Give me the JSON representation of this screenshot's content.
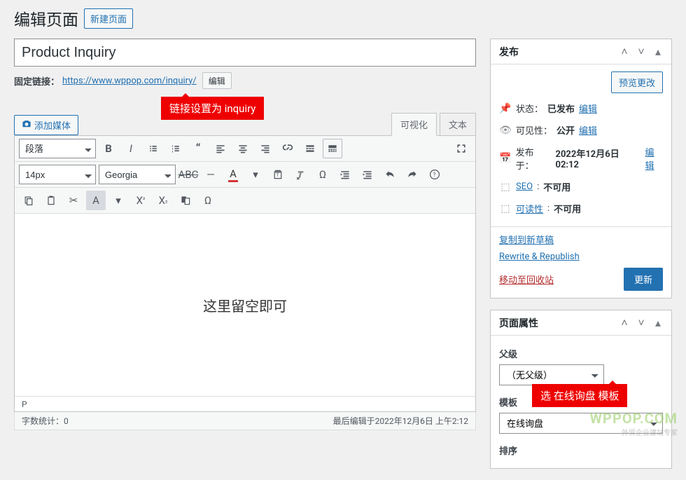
{
  "heading": {
    "title": "编辑页面",
    "new_button": "新建页面"
  },
  "post": {
    "title": "Product Inquiry",
    "permalink_label": "固定链接：",
    "permalink_url": "https://www.wppop.com/inquiry/",
    "permalink_edit": "编辑"
  },
  "callouts": {
    "permalink_tip": "链接设置为 inquiry",
    "template_tip": "选 在线询盘 模板"
  },
  "editor": {
    "add_media": "添加媒体",
    "tab_visual": "可视化",
    "tab_text": "文本",
    "block_format": "段落",
    "font_size": "14px",
    "font_family": "Georgia",
    "placeholder_note": "这里留空即可",
    "path": "P",
    "word_count_label": "字数统计：",
    "word_count": "0",
    "last_edit": "最后编辑于2022年12月6日 上午2:12"
  },
  "publish": {
    "box_title": "发布",
    "preview_btn": "预览更改",
    "status_label": "状态：",
    "status_value": "已发布",
    "edit": "编辑",
    "visibility_label": "可见性：",
    "visibility_value": "公开",
    "published_label": "发布于：",
    "published_value": "2022年12月6日02:12",
    "seo_label": "SEO",
    "seo_value": "不可用",
    "readability_label": "可读性",
    "readability_value": "不可用",
    "copy_draft": "复制到新草稿",
    "rewrite": "Rewrite & Republish",
    "trash": "移动至回收站",
    "update": "更新"
  },
  "page_attr": {
    "box_title": "页面属性",
    "parent_label": "父级",
    "parent_value": "（无父级）",
    "template_label": "模板",
    "template_value": "在线询盘",
    "order_label": "排序"
  },
  "watermark": {
    "brand": "WPPOP.COM",
    "tag": "外贸企业建站专家"
  }
}
